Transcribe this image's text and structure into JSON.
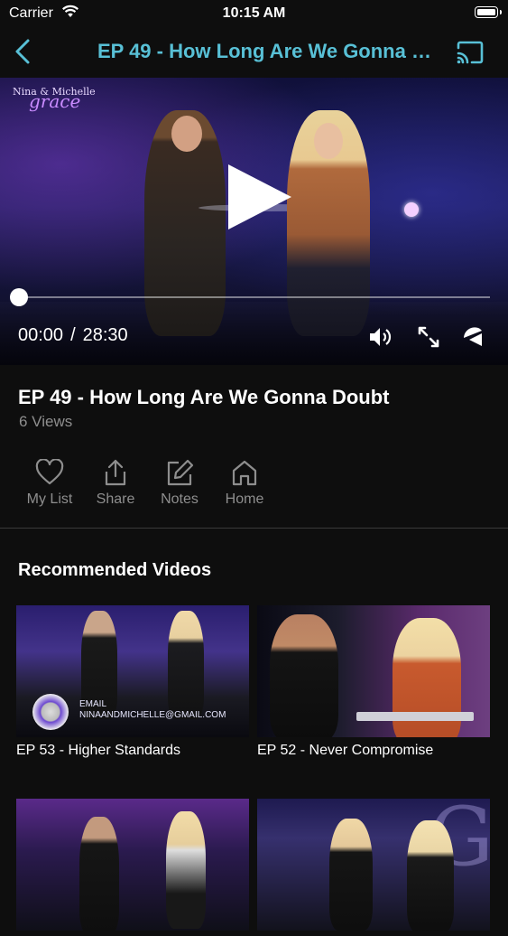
{
  "status_bar": {
    "carrier": "Carrier",
    "time": "10:15 AM"
  },
  "nav": {
    "title": "EP 49 - How Long Are We Gonna Doubt"
  },
  "player": {
    "logo_line1": "Nina & Michelle",
    "logo_line2": "grace",
    "logo_line3": "grace",
    "current_time": "00:00",
    "separator": "/",
    "duration": "28:30",
    "progress": 0
  },
  "video": {
    "title": "EP 49 - How Long Are We Gonna Doubt",
    "views": "6 Views"
  },
  "actions": [
    {
      "label": "My List",
      "icon": "heart-icon"
    },
    {
      "label": "Share",
      "icon": "share-icon"
    },
    {
      "label": "Notes",
      "icon": "edit-icon"
    },
    {
      "label": "Home",
      "icon": "home-icon"
    }
  ],
  "recommended": {
    "heading": "Recommended Videos",
    "items": [
      {
        "title": "EP 53 - Higher Standards",
        "email_label": "EMAIL",
        "email": "NINAANDMICHELLE@GMAIL.COM"
      },
      {
        "title": "EP 52 - Never Compromise"
      },
      {
        "title": ""
      },
      {
        "title": ""
      }
    ]
  },
  "colors": {
    "accent": "#58c0d6",
    "background": "#0e0e0e",
    "muted_text": "#8e8e8e"
  }
}
